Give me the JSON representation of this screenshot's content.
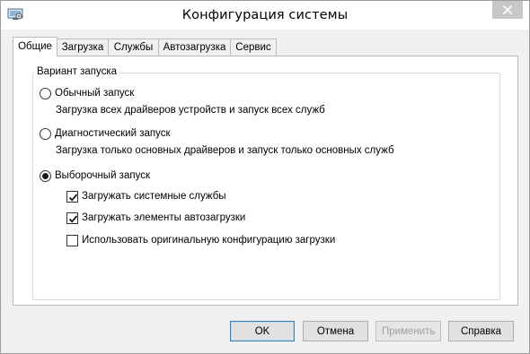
{
  "window": {
    "title": "Конфигурация системы",
    "icons": {
      "app": "system-config-icon",
      "close": "close-icon"
    },
    "accent": "#c7c7c7"
  },
  "tabs": [
    {
      "label": "Общие",
      "active": true
    },
    {
      "label": "Загрузка",
      "active": false
    },
    {
      "label": "Службы",
      "active": false
    },
    {
      "label": "Автозагрузка",
      "active": false
    },
    {
      "label": "Сервис",
      "active": false
    }
  ],
  "startup_group": {
    "label": "Вариант запуска",
    "options": [
      {
        "label": "Обычный запуск",
        "description": "Загрузка всех драйверов устройств и запуск всех служб",
        "selected": false
      },
      {
        "label": "Диагностический запуск",
        "description": "Загрузка только основных драйверов и запуск только основных служб",
        "selected": false
      },
      {
        "label": "Выборочный запуск",
        "selected": true
      }
    ],
    "selective": [
      {
        "label": "Загружать системные службы",
        "checked": true
      },
      {
        "label": "Загружать элементы автозагрузки",
        "checked": true
      },
      {
        "label": "Использовать оригинальную конфигурацию загрузки",
        "checked": false
      }
    ]
  },
  "buttons": {
    "ok": "OK",
    "cancel": "Отмена",
    "apply": "Применить",
    "help": "Справка"
  }
}
